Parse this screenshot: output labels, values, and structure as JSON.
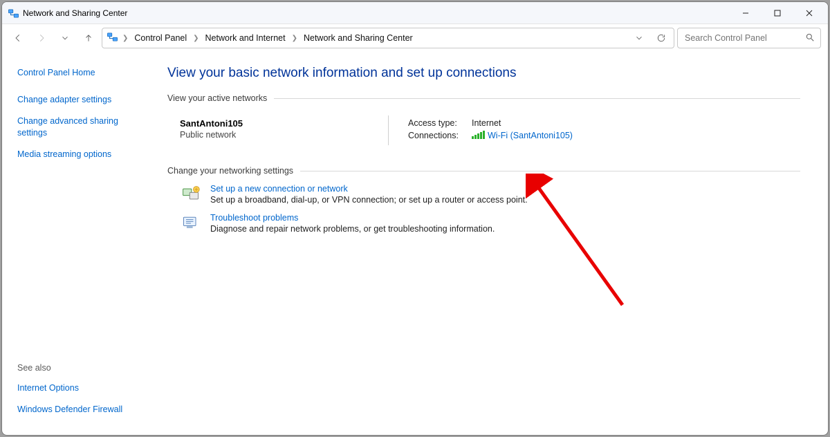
{
  "window": {
    "title": "Network and Sharing Center"
  },
  "breadcrumb": {
    "items": [
      "Control Panel",
      "Network and Internet",
      "Network and Sharing Center"
    ]
  },
  "search": {
    "placeholder": "Search Control Panel"
  },
  "sidebar": {
    "home": "Control Panel Home",
    "links": [
      "Change adapter settings",
      "Change advanced sharing settings",
      "Media streaming options"
    ],
    "see_also_label": "See also",
    "see_also": [
      "Internet Options",
      "Windows Defender Firewall"
    ]
  },
  "main": {
    "heading": "View your basic network information and set up connections",
    "active_label": "View your active networks",
    "network": {
      "name": "SantAntoni105",
      "type": "Public network",
      "access_label": "Access type:",
      "access_value": "Internet",
      "connections_label": "Connections:",
      "connections_value": "Wi-Fi (SantAntoni105)"
    },
    "change_label": "Change your networking settings",
    "tasks": [
      {
        "title": "Set up a new connection or network",
        "desc": "Set up a broadband, dial-up, or VPN connection; or set up a router or access point."
      },
      {
        "title": "Troubleshoot problems",
        "desc": "Diagnose and repair network problems, or get troubleshooting information."
      }
    ]
  }
}
